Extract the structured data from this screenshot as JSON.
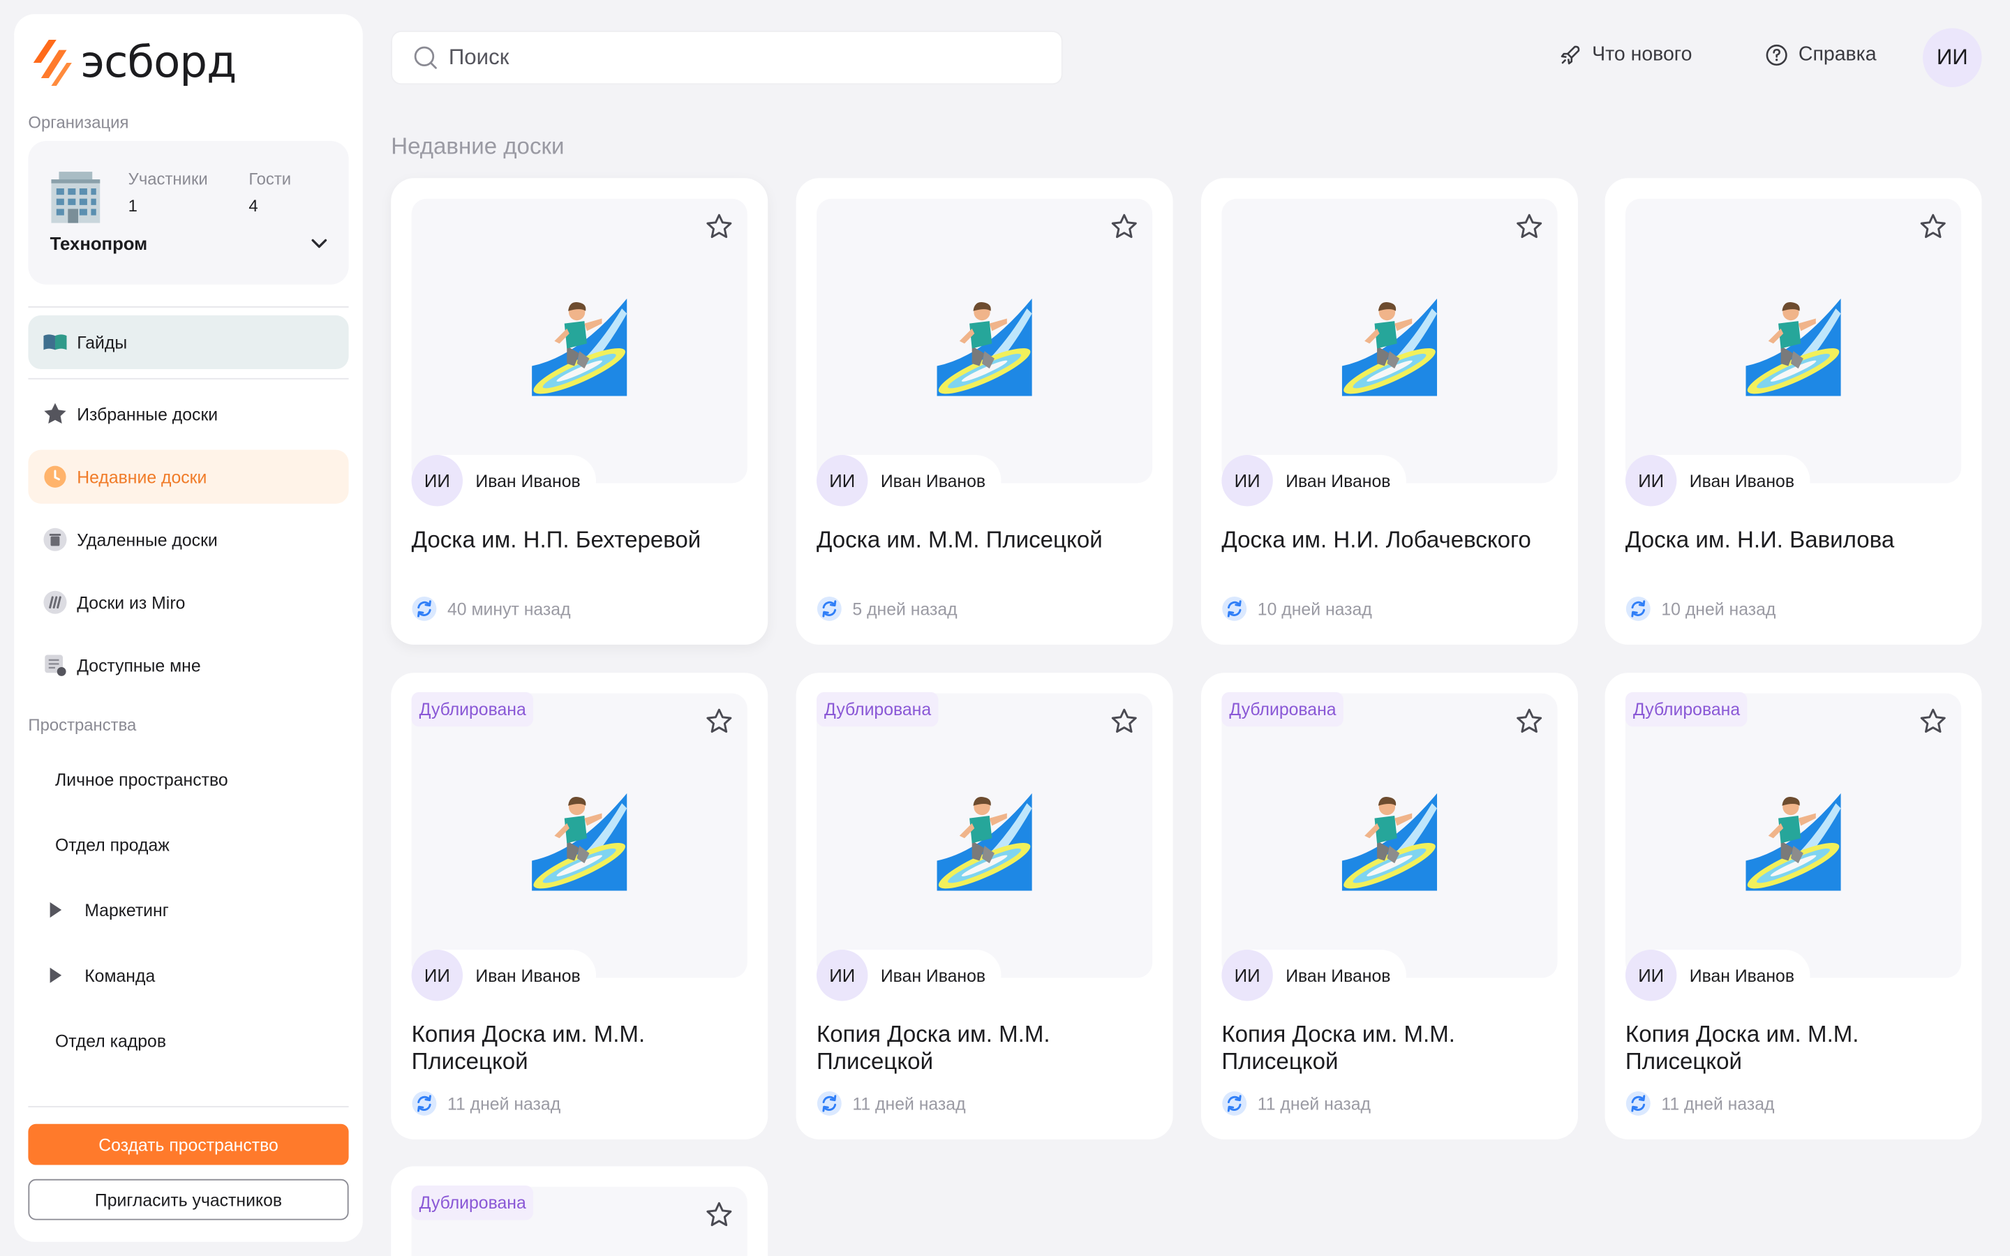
{
  "app": {
    "logo_text": "эсборд"
  },
  "sidebar": {
    "org_section_label": "Организация",
    "org": {
      "members_label": "Участники",
      "members_count": "1",
      "guests_label": "Гости",
      "guests_count": "4",
      "name": "Технопром"
    },
    "guides_label": "Гайды",
    "nav": [
      {
        "label": "Избранные доски"
      },
      {
        "label": "Недавние доски"
      },
      {
        "label": "Удаленные доски"
      },
      {
        "label": "Доски из Miro"
      },
      {
        "label": "Доступные мне"
      }
    ],
    "spaces_label": "Пространства",
    "spaces": [
      {
        "label": "Личное пространство"
      },
      {
        "label": "Отдел продаж"
      },
      {
        "label": "Маркетинг"
      },
      {
        "label": "Команда"
      },
      {
        "label": "Отдел кадров"
      }
    ],
    "create_space_button": "Создать пространство",
    "invite_button": "Пригласить участников"
  },
  "topbar": {
    "search_placeholder": "Поиск",
    "whats_new": "Что нового",
    "help": "Справка",
    "user_initials": "ИИ"
  },
  "main": {
    "title": "Недавние доски",
    "duplicated_badge": "Дублирована",
    "cards": [
      {
        "title": "Доска им. Н.П. Бехтеревой",
        "owner_initials": "ИИ",
        "owner": "Иван Иванов",
        "time": "40 минут назад"
      },
      {
        "title": "Доска им. М.М. Плисецкой",
        "owner_initials": "ИИ",
        "owner": "Иван Иванов",
        "time": "5 дней назад"
      },
      {
        "title": "Доска им. Н.И. Лобачевского",
        "owner_initials": "ИИ",
        "owner": "Иван Иванов",
        "time": "10 дней назад"
      },
      {
        "title": "Доска им. Н.И. Вавилова",
        "owner_initials": "ИИ",
        "owner": "Иван Иванов",
        "time": "10 дней назад"
      },
      {
        "title": "Копия Доска им. М.М. Плисецкой",
        "owner_initials": "ИИ",
        "owner": "Иван Иванов",
        "time": "11 дней назад"
      },
      {
        "title": "Копия Доска им. М.М. Плисецкой",
        "owner_initials": "ИИ",
        "owner": "Иван Иванов",
        "time": "11 дней назад"
      },
      {
        "title": "Копия Доска им. М.М. Плисецкой",
        "owner_initials": "ИИ",
        "owner": "Иван Иванов",
        "time": "11 дней назад"
      },
      {
        "title": "Копия Доска им. М.М. Плисецкой",
        "owner_initials": "ИИ",
        "owner": "Иван Иванов",
        "time": "11 дней назад"
      }
    ]
  },
  "colors": {
    "accent": "#ff7a2b",
    "active_bg": "#fff3e8",
    "avatar_bg": "#ebe6fb",
    "badge_text": "#8a58d6"
  },
  "icons": {
    "logo": "esbord-logo-icon",
    "org": "office-building-icon",
    "guides": "open-book-icon",
    "favorites": "star-badge-icon",
    "recent": "clock-icon",
    "deleted": "trash-icon",
    "miro": "miro-icon",
    "shared": "shared-doc-icon",
    "search": "search-icon",
    "whats_new": "rocket-icon",
    "help": "question-circle-icon",
    "board_preview": "surfer-icon",
    "favorite_toggle": "star-outline-icon",
    "sync": "sync-icon"
  }
}
